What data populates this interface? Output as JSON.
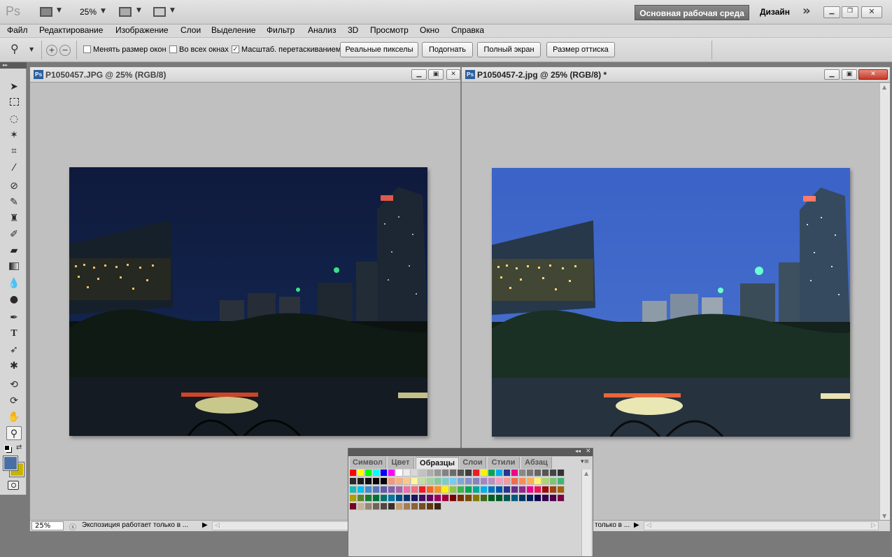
{
  "app": {
    "logo": "Ps",
    "zoom": "25%",
    "workspace_active": "Основная рабочая среда",
    "workspace_other": "Дизайн",
    "more": "»"
  },
  "menu": [
    "Файл",
    "Редактирование",
    "Изображение",
    "Слои",
    "Выделение",
    "Фильтр",
    "Анализ",
    "3D",
    "Просмотр",
    "Окно",
    "Справка"
  ],
  "options": {
    "resize_windows": "Менять размер окон",
    "all_windows": "Во всех окнах",
    "scrubby_zoom": "Масштаб. перетаскиванием",
    "actual_pixels": "Реальные пикселы",
    "fit_screen": "Подогнать",
    "fill_screen": "Полный экран",
    "print_size": "Размер оттиска",
    "resize_windows_checked": false,
    "all_windows_checked": false,
    "scrubby_zoom_checked": true
  },
  "doc1": {
    "title": "P1050457.JPG @ 25% (RGB/8)",
    "zoom": "25%",
    "status": "Экспозиция работает только в ..."
  },
  "doc2": {
    "title": "P1050457-2.jpg @ 25% (RGB/8) *",
    "status": "только в ..."
  },
  "panel": {
    "tabs": [
      "Символ",
      "Цвет",
      "Образцы",
      "Слои",
      "Стили",
      "Абзац"
    ],
    "active_tab": "Образцы"
  },
  "colors": {
    "foreground": "#4a6fa5",
    "background": "#c8b400"
  },
  "icons": {
    "zoom_tool": "magnifier-icon",
    "zoom_in": "zoom-in-icon",
    "zoom_out": "zoom-out-icon"
  }
}
